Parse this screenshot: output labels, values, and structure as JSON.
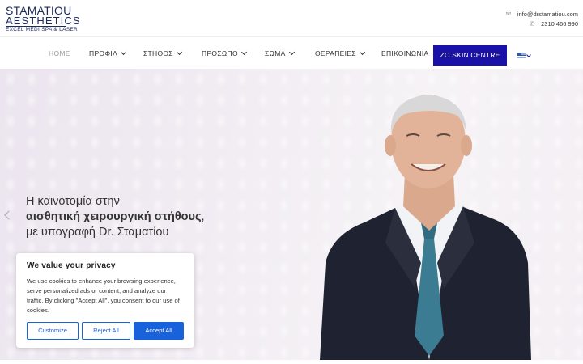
{
  "brand": {
    "line1": "STAMATIOU",
    "line2": "AESTHETICS",
    "line3": "EXCEL MEDI SPA & LASER"
  },
  "contact": {
    "email": "info@drstamatiou.com",
    "phone": "2310 466 990"
  },
  "nav": {
    "items": [
      {
        "label": "HOME"
      },
      {
        "label": "ΠΡΟΦΙΛ"
      },
      {
        "label": "ΣΤΗΘΟΣ"
      },
      {
        "label": "ΠΡΟΣΩΠΟ"
      },
      {
        "label": "ΣΩΜΑ"
      },
      {
        "label": "ΘΕΡΑΠΕΙΕΣ"
      },
      {
        "label": "ΕΠΙΚΟΙΝΩΝΙΑ"
      }
    ],
    "cta": "ZO SKIN CENTRE",
    "language_icon": "greek-flag-icon"
  },
  "hero": {
    "line1": "Η καινοτομία στην",
    "line2_bold": "αισθητική χειρουργική στήθους",
    "line2_suffix": ",",
    "line3": "με υπογραφή Dr. Σταματίου"
  },
  "cookie": {
    "title": "We value your privacy",
    "body": "We use cookies to enhance your browsing experience, serve personalized ads or content, and analyze our traffic. By clicking \"Accept All\", you consent to our use of cookies.",
    "customize": "Customize",
    "reject": "Reject All",
    "accept": "Accept All"
  },
  "colors": {
    "brand_navy": "#1c2a5c",
    "cta_blue": "#1a12a8",
    "cookie_blue": "#1863dc"
  }
}
